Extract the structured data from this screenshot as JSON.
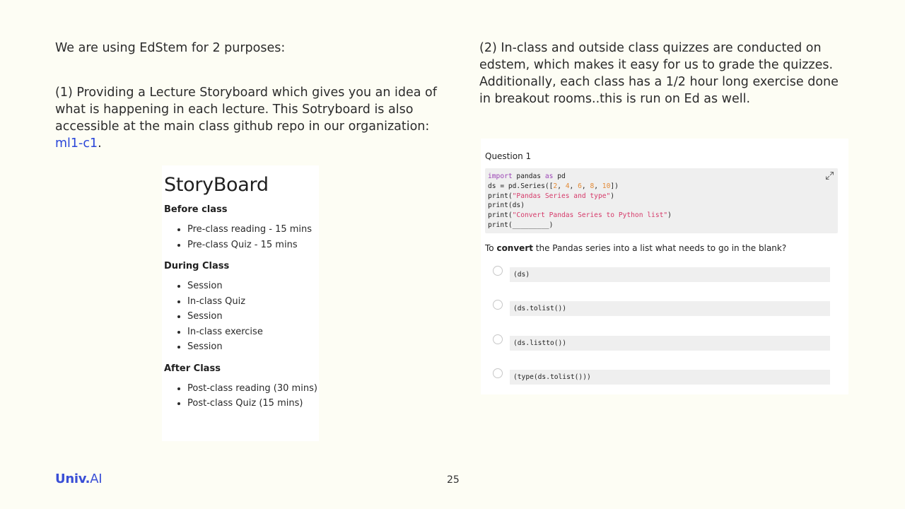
{
  "slide": {
    "intro": "We are using EdStem for 2 purposes:",
    "para1_text": "(1) Providing a Lecture Storyboard which gives you an idea of what is happening in each lecture. This Sotryboard is also accessible at the main class github repo in our organization: ",
    "para1_link": "ml1-c1",
    "para1_end": ".",
    "para2": "(2) In-class and outside class quizzes are conducted on edstem, which makes it easy for us to grade the quizzes. Additionally, each class has a 1/2 hour long exercise done in breakout rooms..this is run on Ed as well.",
    "page_number": "25",
    "logo_main": "Univ.",
    "logo_ai": "AI",
    "link_color": "#2945d9",
    "brand_color": "#3a4fd6"
  },
  "storyboard": {
    "title": "StoryBoard",
    "sections": [
      {
        "heading": "Before class",
        "items": [
          "Pre-class reading - 15 mins",
          "Pre-class Quiz - 15 mins"
        ]
      },
      {
        "heading": "During Class",
        "items": [
          "Session",
          "In-class Quiz",
          "Session",
          "In-class exercise",
          "Session"
        ]
      },
      {
        "heading": "After Class",
        "items": [
          "Post-class reading (30 mins)",
          "Post-class Quiz (15 mins)"
        ]
      }
    ]
  },
  "quiz": {
    "title": "Question 1",
    "code": {
      "l1_kw1": "import",
      "l1_a": " pandas ",
      "l1_kw2": "as",
      "l1_b": " pd",
      "l2_a": "ds = pd.Series([",
      "n1": "2",
      "n2": "4",
      "n3": "6",
      "n4": "8",
      "n5": "10",
      "sep": ", ",
      "l2_b": "])",
      "l3_a": "print(",
      "l3_s": "\"Pandas Series and type\"",
      "l3_b": ")",
      "l4": "print(ds)",
      "l5_a": "print(",
      "l5_s": "\"Convert Pandas Series to Python list\"",
      "l5_b": ")",
      "l6": "print(_________)"
    },
    "question_pre": "To ",
    "question_bold": "convert",
    "question_post": " the Pandas series into a list what needs to go in the blank?",
    "options": [
      "(ds)",
      "(ds.tolist())",
      "(ds.listto())",
      "(type(ds.tolist()))"
    ]
  }
}
